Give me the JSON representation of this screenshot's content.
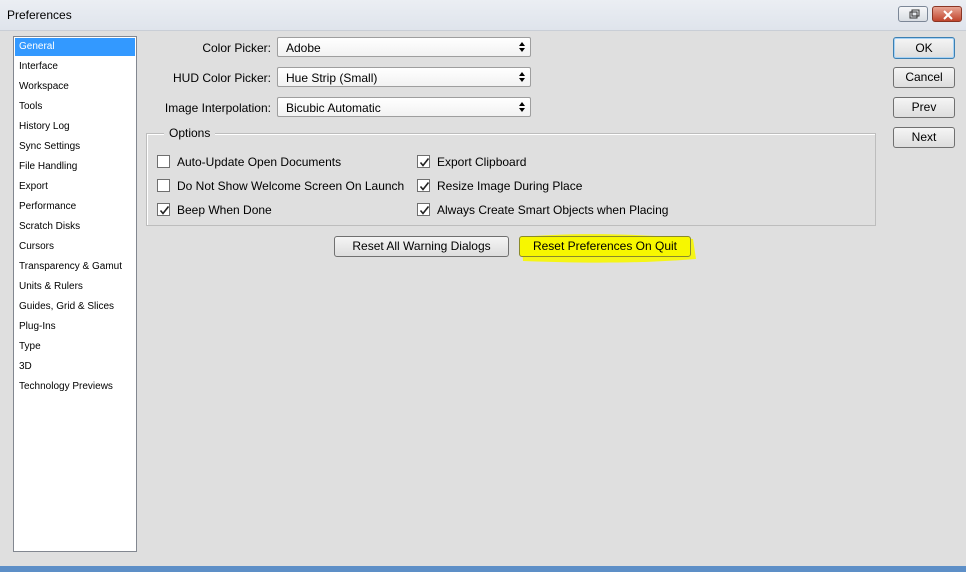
{
  "window": {
    "title": "Preferences"
  },
  "sidebar": {
    "selected_index": 0,
    "items": [
      {
        "label": "General"
      },
      {
        "label": "Interface"
      },
      {
        "label": "Workspace"
      },
      {
        "label": "Tools"
      },
      {
        "label": "History Log"
      },
      {
        "label": "Sync Settings"
      },
      {
        "label": "File Handling"
      },
      {
        "label": "Export"
      },
      {
        "label": "Performance"
      },
      {
        "label": "Scratch Disks"
      },
      {
        "label": "Cursors"
      },
      {
        "label": "Transparency & Gamut"
      },
      {
        "label": "Units & Rulers"
      },
      {
        "label": "Guides, Grid & Slices"
      },
      {
        "label": "Plug-Ins"
      },
      {
        "label": "Type"
      },
      {
        "label": "3D"
      },
      {
        "label": "Technology Previews"
      }
    ]
  },
  "general": {
    "color_picker": {
      "label": "Color Picker:",
      "value": "Adobe"
    },
    "hud_color_picker": {
      "label": "HUD Color Picker:",
      "value": "Hue Strip (Small)"
    },
    "image_interpolation": {
      "label": "Image Interpolation:",
      "value": "Bicubic Automatic"
    },
    "options": {
      "legend": "Options",
      "checkboxes": [
        {
          "label": "Auto-Update Open Documents",
          "checked": false
        },
        {
          "label": "Do Not Show Welcome Screen On Launch",
          "checked": false
        },
        {
          "label": "Beep When Done",
          "checked": true
        },
        {
          "label": "Export Clipboard",
          "checked": true
        },
        {
          "label": "Resize Image During Place",
          "checked": true
        },
        {
          "label": "Always Create Smart Objects when Placing",
          "checked": true
        }
      ]
    },
    "reset_warning_label": "Reset All Warning Dialogs",
    "reset_prefs_label": "Reset Preferences On Quit"
  },
  "actions": {
    "ok_label": "OK",
    "cancel_label": "Cancel",
    "prev_label": "Prev",
    "next_label": "Next"
  },
  "colors": {
    "selection": "#3399ff",
    "highlight": "#f7f700",
    "dialog_bg": "#dfdfdf"
  }
}
